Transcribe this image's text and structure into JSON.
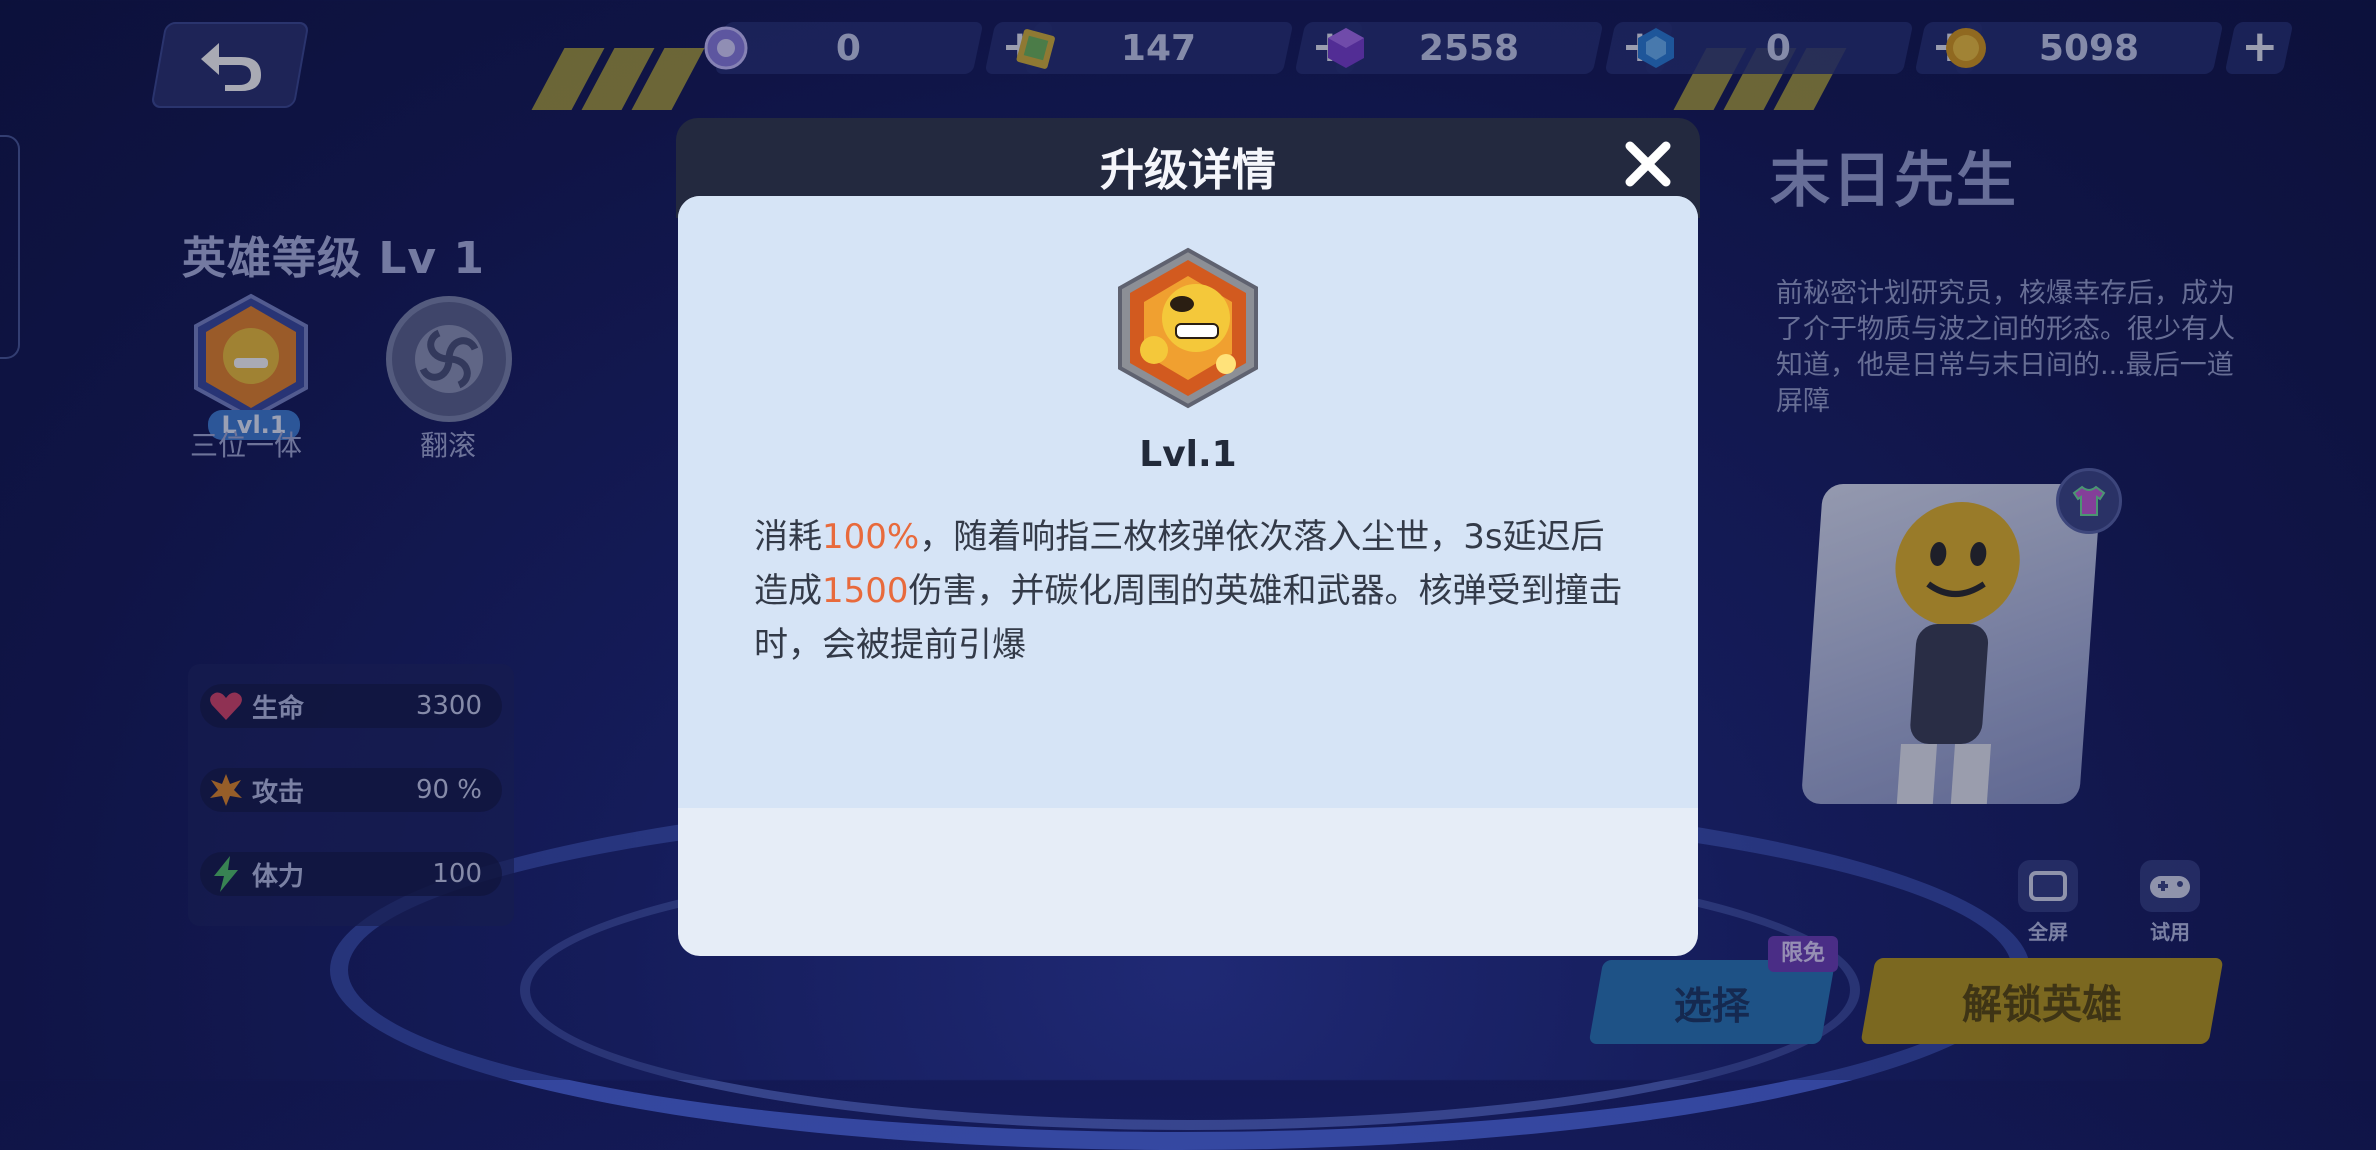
{
  "currencies": [
    {
      "icon": "purple-orb-icon",
      "value": "0"
    },
    {
      "icon": "ticket-icon",
      "value": "147"
    },
    {
      "icon": "purple-cube-icon",
      "value": "2558"
    },
    {
      "icon": "blue-gem-icon",
      "value": "0"
    },
    {
      "icon": "gold-coin-icon",
      "value": "5098"
    }
  ],
  "plus_label": "+",
  "hero": {
    "level_label": "英雄等级 Lv 1",
    "skills": [
      {
        "name": "三位一体",
        "level": "Lvl.1"
      },
      {
        "name": "翻滚"
      }
    ],
    "stats": [
      {
        "icon": "heart-icon",
        "name": "生命",
        "value": "3300"
      },
      {
        "icon": "explosion-icon",
        "name": "攻击",
        "value": "90 %"
      },
      {
        "icon": "lightning-icon",
        "name": "体力",
        "value": "100"
      }
    ],
    "name": "末日先生",
    "description": "前秘密计划研究员，核爆幸存后，成为了介于物质与波之间的形态。很少有人知道，他是日常与末日间的...最后一道屏障"
  },
  "tools": {
    "fullscreen": "全屏",
    "trial": "试用"
  },
  "buttons": {
    "select": "选择",
    "free_tag": "限免",
    "unlock": "解锁英雄"
  },
  "modal": {
    "title": "升级详情",
    "level": "Lvl.1",
    "desc": {
      "p1": "消耗",
      "h1": "100%",
      "p2": "，随着响指三枚核弹依次落入尘世，3s延迟后造成",
      "h2": "1500",
      "p3": "伤害，并碳化周围的英雄和武器。核弹受到撞击时，会被提前引爆"
    },
    "highlight_color": "#e86a3c"
  }
}
